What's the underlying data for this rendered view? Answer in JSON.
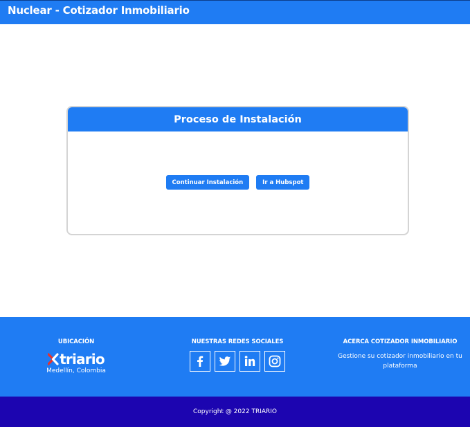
{
  "header": {
    "title": "Nuclear - Cotizador Inmobiliario"
  },
  "card": {
    "title": "Proceso de Instalación",
    "continue_label": "Continuar Instalación",
    "hubspot_label": "Ir a Hubspot"
  },
  "footer": {
    "location": {
      "heading": "UBICACIÓN",
      "logo_text": "triario",
      "city": "Medellín, Colombia"
    },
    "social": {
      "heading": "NUESTRAS REDES SOCIALES",
      "icons": [
        "facebook-icon",
        "twitter-icon",
        "linkedin-icon",
        "instagram-icon"
      ]
    },
    "about": {
      "heading": "ACERCA COTIZADOR INMOBILIARIO",
      "text": "Gestione su cotizador inmobiliario en tu plataforma"
    },
    "copyright": "Copyright @ 2022 TRIARIO"
  },
  "colors": {
    "primary": "#1f7cf3",
    "copyright_bar": "#1c05b0",
    "logo_accent": "#e8322d",
    "card_border": "#d4d4d4"
  }
}
